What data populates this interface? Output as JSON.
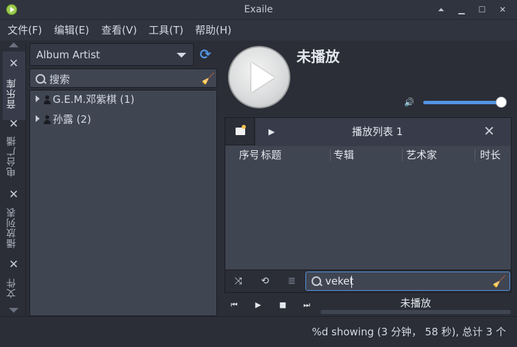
{
  "window": {
    "title": "Exaile",
    "controls": {
      "shade": "⏶",
      "minimize": "▁",
      "maximize": "☐",
      "close": "✕"
    }
  },
  "menu": [
    "文件(F)",
    "编辑(E)",
    "查看(V)",
    "工具(T)",
    "帮助(H)"
  ],
  "side_tabs": [
    {
      "label": "音乐库",
      "active": true
    },
    {
      "label": "电台广播",
      "active": false
    },
    {
      "label": "播放列表",
      "active": false
    },
    {
      "label": "文件",
      "active": false
    }
  ],
  "collection": {
    "group_by": "Album Artist",
    "search_placeholder": "搜索",
    "artists": [
      {
        "name": "G.E.M.邓紫棋",
        "count": "(1)"
      },
      {
        "name": "孙露",
        "count": "(2)"
      }
    ]
  },
  "player": {
    "now_playing": "未播放",
    "volume": 1.0
  },
  "playlist": {
    "tab_label": "播放列表 1",
    "columns": [
      "序号",
      "标题",
      "专辑",
      "艺术家",
      "时长"
    ],
    "filter_value": "veket"
  },
  "transport": {
    "status": "未播放",
    "progress": 0
  },
  "statusbar": {
    "text": "%d showing (3 分钟， 58 秒), 总计 3 个"
  },
  "colors": {
    "accent": "#5294e2",
    "background": "#2b2e37",
    "panel": "#404552"
  }
}
